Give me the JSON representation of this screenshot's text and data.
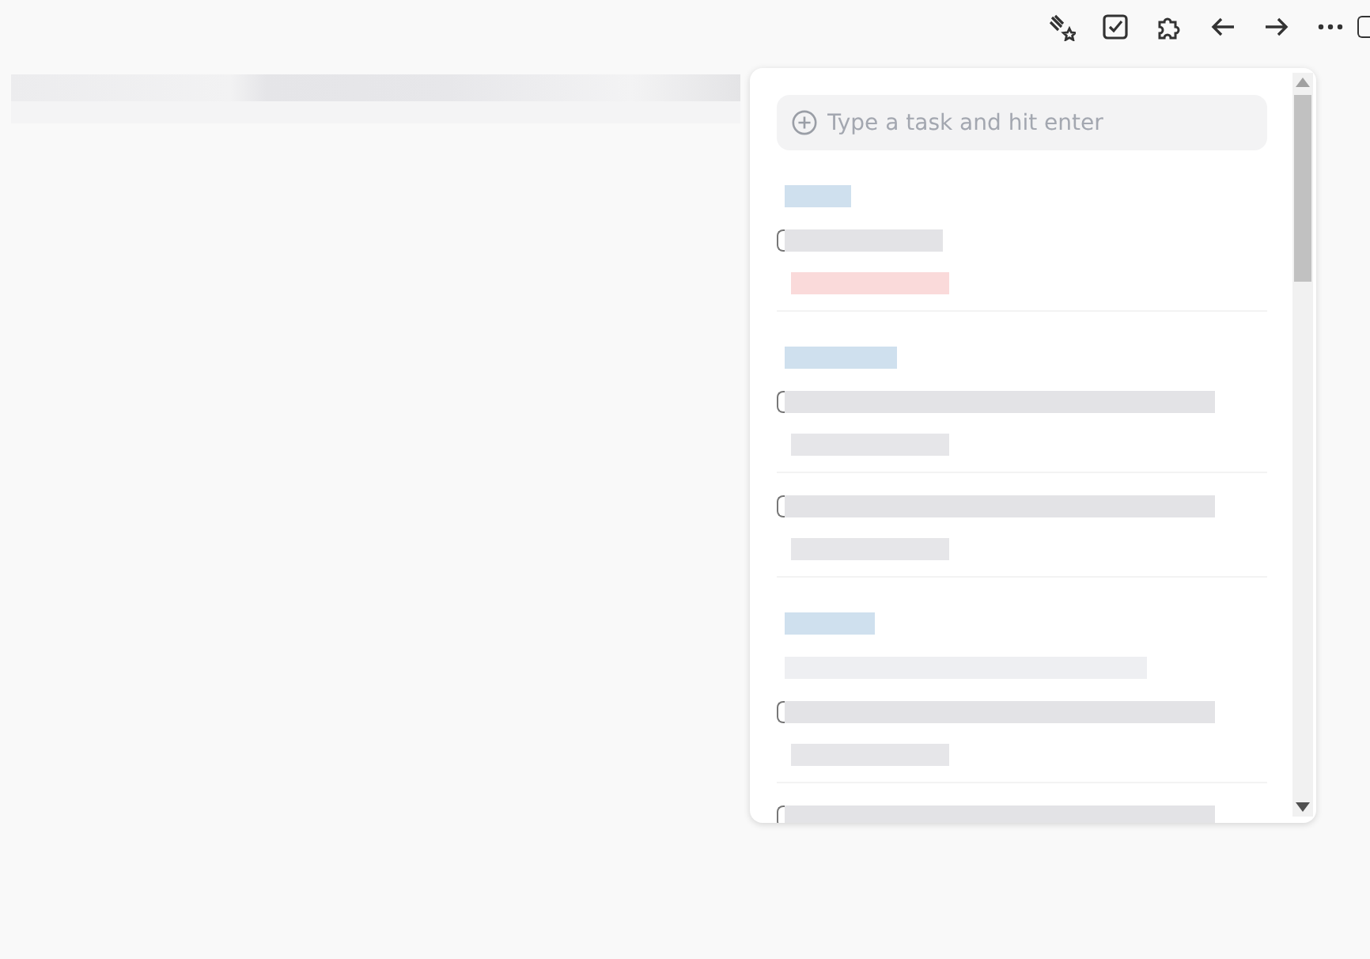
{
  "task_panel": {
    "input": {
      "placeholder": "Type a task and hit enter"
    },
    "sections": [
      {
        "kind": "plain",
        "items": [
          {
            "kind": "due",
            "checked": false
          }
        ]
      },
      {
        "kind": "plain",
        "items": [
          {
            "kind": "note",
            "checked": false
          },
          {
            "kind": "note",
            "checked": false
          }
        ]
      },
      {
        "kind": "subheaded",
        "items": [
          {
            "kind": "note",
            "checked": false
          },
          {
            "kind": "plain",
            "checked": false
          }
        ]
      }
    ]
  }
}
